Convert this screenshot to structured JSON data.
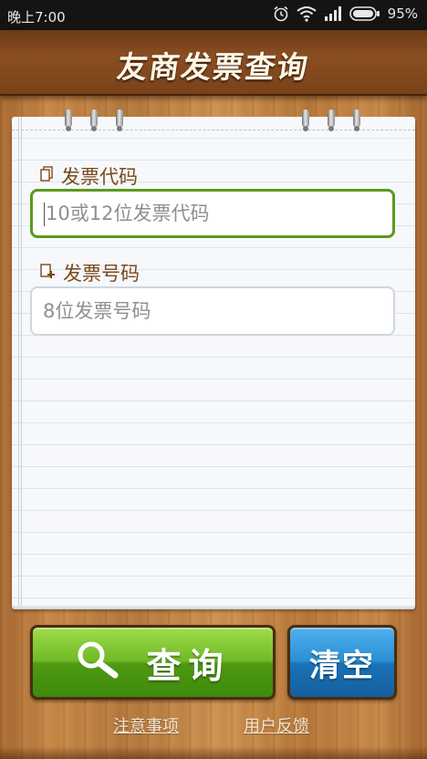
{
  "status_bar": {
    "time": "晚上7:00",
    "battery_percent": "95%",
    "icons": [
      "alarm-icon",
      "wifi-icon",
      "signal-icon",
      "battery-icon"
    ]
  },
  "header": {
    "title": "友商发票查询"
  },
  "form": {
    "invoice_code": {
      "label": "发票代码",
      "placeholder": "10或12位发票代码",
      "icon": "document-icon",
      "focused": true
    },
    "invoice_number": {
      "label": "发票号码",
      "placeholder": "8位发票号码",
      "icon": "document-add-icon"
    }
  },
  "actions": {
    "query_label": "查询",
    "query_icon": "search-icon",
    "clear_label": "清空"
  },
  "footer": {
    "notes_link": "注意事项",
    "feedback_link": "用户反馈"
  },
  "colors": {
    "accent_green": "#5a9a1a",
    "clear_blue": "#2a8fd4",
    "label_brown": "#7a4a1c"
  }
}
